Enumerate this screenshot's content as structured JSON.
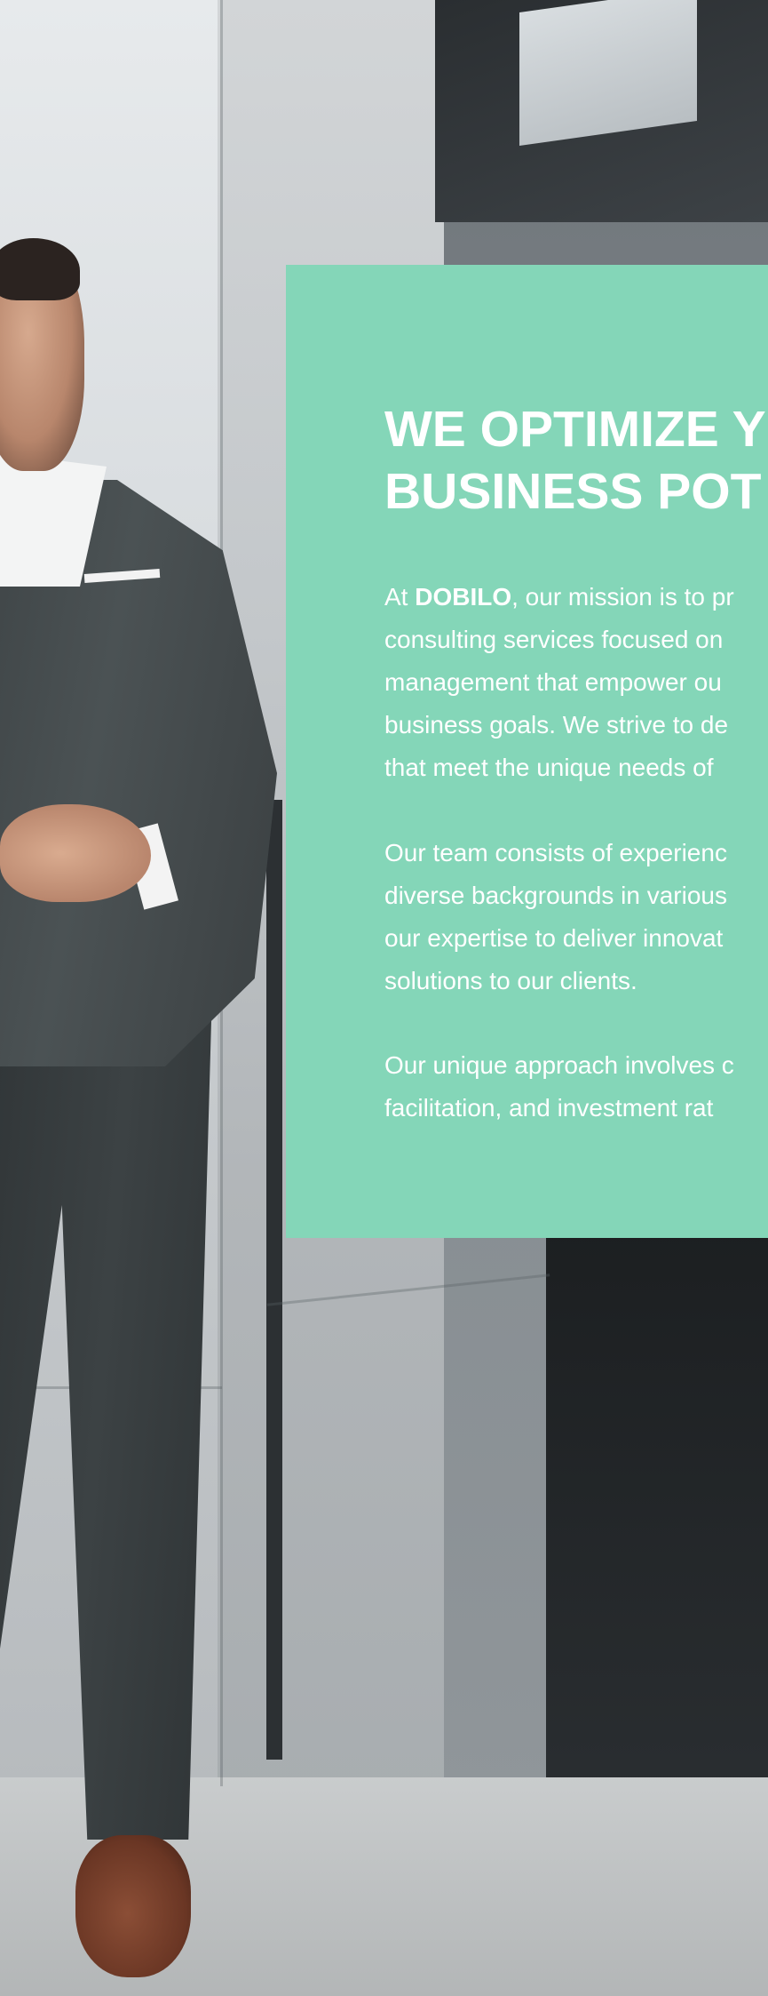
{
  "hero": {
    "headline_line1": "WE OPTIMIZE Y",
    "headline_line2": "BUSINESS POT",
    "paragraph1": {
      "prefix": "At ",
      "brand": "DOBILO",
      "line1_suffix": ", our mission is to pr",
      "line2": "consulting services focused on",
      "line3": "management that empower ou",
      "line4": "business goals. We strive to de",
      "line5": "that meet the unique needs of"
    },
    "paragraph2": {
      "line1": "Our team consists of experienc",
      "line2": "diverse backgrounds in various",
      "line3": "our expertise to deliver innovat",
      "line4": "solutions to our clients."
    },
    "paragraph3": {
      "line1": "Our unique approach involves c",
      "line2": "facilitation, and investment rat"
    }
  },
  "colors": {
    "card_background": "#84d6b8",
    "card_text": "#ffffff"
  },
  "background_image": "businessman-walking-past-building-photo"
}
